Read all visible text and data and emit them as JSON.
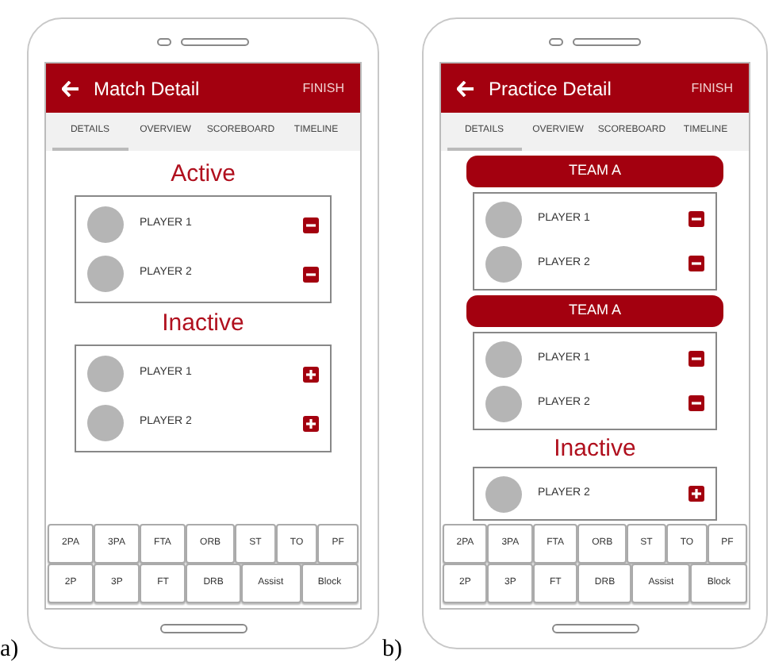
{
  "panels": [
    {
      "caption": "a)",
      "title": "Match Detail",
      "action": "FINISH",
      "tabs": [
        {
          "label": "DETAILS",
          "selected": true
        },
        {
          "label": "OVERVIEW",
          "selected": false
        },
        {
          "label": "SCOREBOARD",
          "selected": false
        },
        {
          "label": "TIMELINE",
          "selected": false
        }
      ],
      "sections": [
        {
          "kind": "heading",
          "text": "Active"
        },
        {
          "kind": "players",
          "players": [
            {
              "name": "PLAYER 1",
              "kind": "remove"
            },
            {
              "name": "PLAYER 2",
              "kind": "remove"
            }
          ]
        },
        {
          "kind": "heading",
          "text": "Inactive"
        },
        {
          "kind": "players",
          "players": [
            {
              "name": "PLAYER 1",
              "kind": "add"
            },
            {
              "name": "PLAYER 2",
              "kind": "add"
            }
          ]
        }
      ],
      "keys": [
        [
          "2PA",
          "3PA",
          "FTA",
          "ORB",
          "ST",
          "TO",
          "PF"
        ],
        [
          "2P",
          "3P",
          "FT",
          "DRB",
          "Assist",
          "Block"
        ]
      ]
    },
    {
      "caption": "b)",
      "title": "Practice Detail",
      "action": "FINISH",
      "tabs": [
        {
          "label": "DETAILS",
          "selected": true
        },
        {
          "label": "OVERVIEW",
          "selected": false
        },
        {
          "label": "SCOREBOARD",
          "selected": false
        },
        {
          "label": "TIMELINE",
          "selected": false
        }
      ],
      "sections": [
        {
          "kind": "team",
          "text": "TEAM A"
        },
        {
          "kind": "players",
          "players": [
            {
              "name": "PLAYER 1",
              "kind": "remove"
            },
            {
              "name": "PLAYER 2",
              "kind": "remove"
            }
          ]
        },
        {
          "kind": "team",
          "text": "TEAM A"
        },
        {
          "kind": "players",
          "players": [
            {
              "name": "PLAYER 1",
              "kind": "remove"
            },
            {
              "name": "PLAYER 2",
              "kind": "remove"
            }
          ]
        },
        {
          "kind": "heading",
          "text": "Inactive"
        },
        {
          "kind": "players",
          "players": [
            {
              "name": "PLAYER 2",
              "kind": "add"
            }
          ]
        }
      ],
      "keys": [
        [
          "2PA",
          "3PA",
          "FTA",
          "ORB",
          "ST",
          "TO",
          "PF"
        ],
        [
          "2P",
          "3P",
          "FT",
          "DRB",
          "Assist",
          "Block"
        ]
      ]
    }
  ]
}
